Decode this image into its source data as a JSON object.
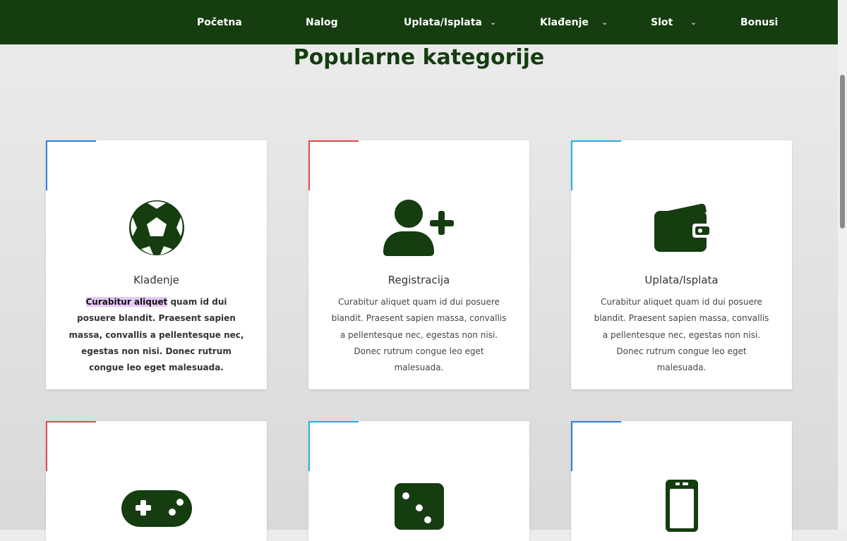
{
  "nav": {
    "items": [
      {
        "label": "Početna",
        "has_dropdown": false
      },
      {
        "label": "Nalog",
        "has_dropdown": false
      },
      {
        "label": "Uplata/Isplata",
        "has_dropdown": true
      },
      {
        "label": "Klađenje",
        "has_dropdown": true
      },
      {
        "label": "Slot",
        "has_dropdown": true
      },
      {
        "label": "Bonusi",
        "has_dropdown": false
      }
    ],
    "dropdown_glyph": "⌄",
    "background": "#153d10"
  },
  "section": {
    "title": "Popularne kategorije"
  },
  "cards": [
    {
      "title": "Klađenje",
      "icon": "soccer-ball-icon",
      "accent": "#2f7fd8",
      "text_highlight": "Curabitur aliquet",
      "text_rest": " quam id dui posuere blandit. Praesent sapien massa, convallis a pellentesque nec, egestas non nisi. Donec rutrum congue leo eget malesuada."
    },
    {
      "title": "Registracija",
      "icon": "user-plus-icon",
      "accent": "#e24a4a",
      "text": "Curabitur aliquet quam id dui posuere blandit. Praesent sapien massa, convallis a pellentesque nec, egestas non nisi. Donec rutrum congue leo eget malesuada."
    },
    {
      "title": "Uplata/Isplata",
      "icon": "wallet-icon",
      "accent": "#1fb2e0",
      "text": "Curabitur aliquet quam id dui posuere blandit. Praesent sapien massa, convallis a pellentesque nec, egestas non nisi. Donec rutrum congue leo eget malesuada."
    },
    {
      "title": "",
      "icon": "gamepad-icon",
      "accent": "#e24a4a"
    },
    {
      "title": "",
      "icon": "dice-icon",
      "accent": "#1fb2e0"
    },
    {
      "title": "",
      "icon": "mobile-phone-icon",
      "accent": "#2f7fd8"
    }
  ],
  "colors": {
    "brand_green": "#153d10",
    "highlight": "#e6c9f5"
  }
}
